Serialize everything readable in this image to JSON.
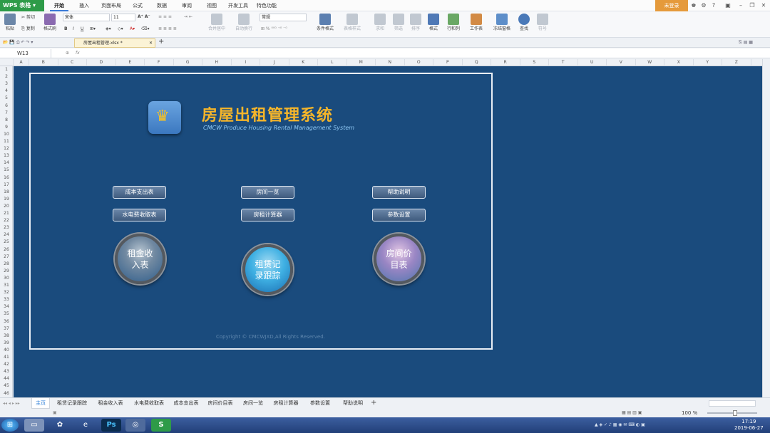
{
  "titlebar": {
    "app_name": "WPS 表格",
    "menu": [
      "开始",
      "插入",
      "页面布局",
      "公式",
      "数据",
      "审阅",
      "视图",
      "开发工具",
      "特色功能"
    ],
    "login": "未登录",
    "help": "?"
  },
  "ribbon": {
    "paste": "粘贴",
    "cut": "剪切",
    "copy": "复制",
    "format_painter": "格式刷",
    "font_name": "宋体",
    "font_size": "11",
    "merge": "合并居中",
    "wrap": "自动换行",
    "num_format": "常规",
    "cond_format": "条件格式",
    "table_style": "表格样式",
    "sum": "求和",
    "filter": "筛选",
    "sort": "排序",
    "format": "格式",
    "rowcol": "行和列",
    "worksheet": "工作表",
    "freeze": "冻结窗格",
    "find": "查找",
    "symbol": "符号"
  },
  "file": {
    "tab_label": "房屋出租管理.xlsx *"
  },
  "formula": {
    "cell_ref": "W13",
    "fx": "fx"
  },
  "columns": [
    "A",
    "B",
    "C",
    "D",
    "E",
    "F",
    "G",
    "H",
    "I",
    "J",
    "K",
    "L",
    "M",
    "N",
    "O",
    "P",
    "Q",
    "R",
    "S",
    "T",
    "U",
    "V",
    "W",
    "X",
    "Y",
    "Z"
  ],
  "rows": [
    "1",
    "2",
    "3",
    "4",
    "5",
    "6",
    "7",
    "8",
    "9",
    "10",
    "11",
    "12",
    "13",
    "14",
    "15",
    "16",
    "17",
    "18",
    "19",
    "20",
    "21",
    "22",
    "23",
    "24",
    "25",
    "26",
    "27",
    "28",
    "29",
    "30",
    "31",
    "32",
    "33",
    "34",
    "35",
    "36",
    "37",
    "38",
    "39",
    "40",
    "41",
    "42",
    "43",
    "44",
    "45",
    "46"
  ],
  "app": {
    "title": "房屋出租管理系统",
    "subtitle": "CMCW Produce Housing Rental Management System",
    "buttons": {
      "cost": "成本支出表",
      "rooms": "房间一览",
      "help": "帮助说明",
      "utility": "水电费收取表",
      "rent_calc": "房租计算器",
      "params": "参数设置"
    },
    "orbs": {
      "rent_income": "租金收入表",
      "rent_record": "租赁记录跟踪",
      "price_list": "房间价目表"
    },
    "copyright": "Copyright © CMCWJXD,All Rights Reserved."
  },
  "sheet_tabs": [
    "主页",
    "租赁记录跟踪",
    "租金收入表",
    "水电费收取表",
    "成本支出表",
    "房间价目表",
    "房间一览",
    "房租计算器",
    "参数设置",
    "帮助说明"
  ],
  "status": {
    "zoom": "100 %"
  },
  "taskbar": {
    "time": "17:19",
    "date": "2019-06-27"
  },
  "colors": {
    "sheet_bg": "#1a4b7d",
    "title": "#f5b52a",
    "accent": "#2e9b48"
  }
}
